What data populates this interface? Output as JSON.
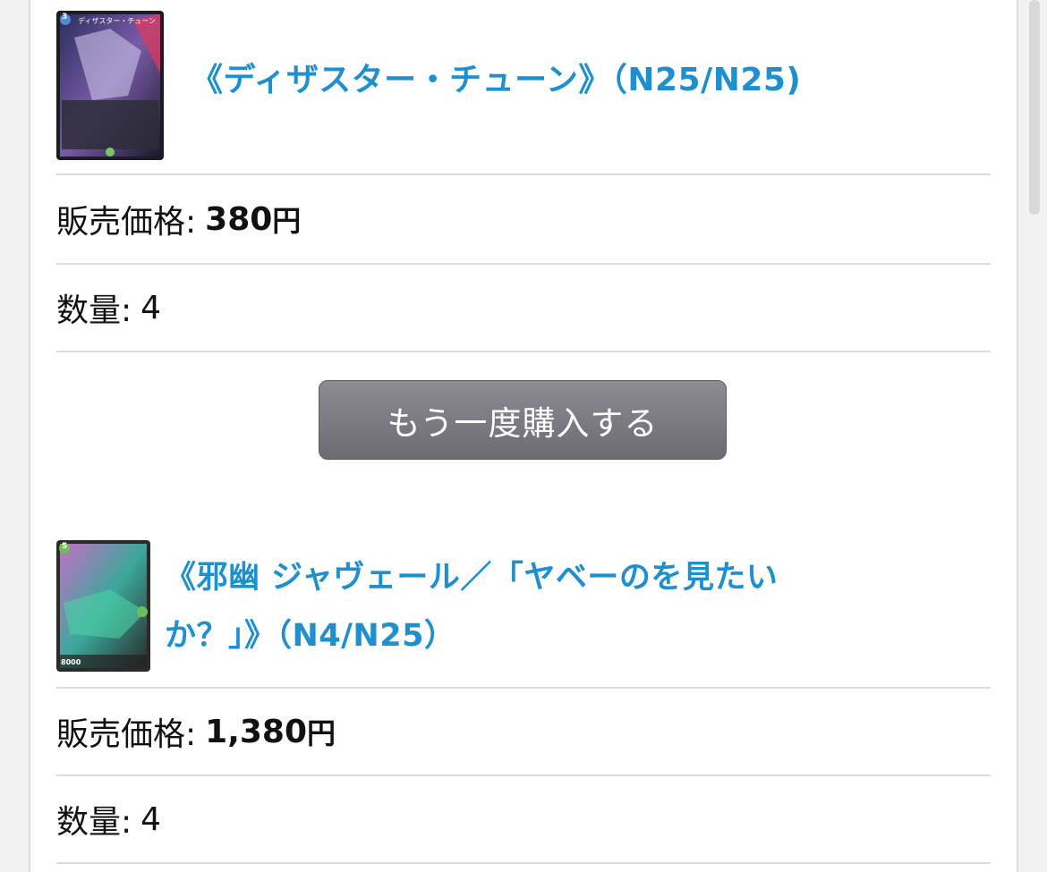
{
  "items": [
    {
      "title": "《ディザスター・チューン》（N25/N25)",
      "card_cost": "3",
      "card_name_small": "ディザスター・チューン",
      "price_label": "販売価格:",
      "price_value": "380",
      "price_unit": "円",
      "qty_label": "数量:",
      "qty_value": "4",
      "rebuy_label": "もう一度購入する"
    },
    {
      "title_line1": "《邪幽 ジャヴェール／「ヤベーのを見たい",
      "title_line2": "か？」》（N4/N25）",
      "card_cost": "5",
      "card_power": "8000",
      "price_label": "販売価格:",
      "price_value": "1,380",
      "price_unit": "円",
      "qty_label": "数量:",
      "qty_value": "4"
    }
  ],
  "colors": {
    "link": "#1e8fcf",
    "button": "#7a7880",
    "divider": "#dcdcdc"
  }
}
